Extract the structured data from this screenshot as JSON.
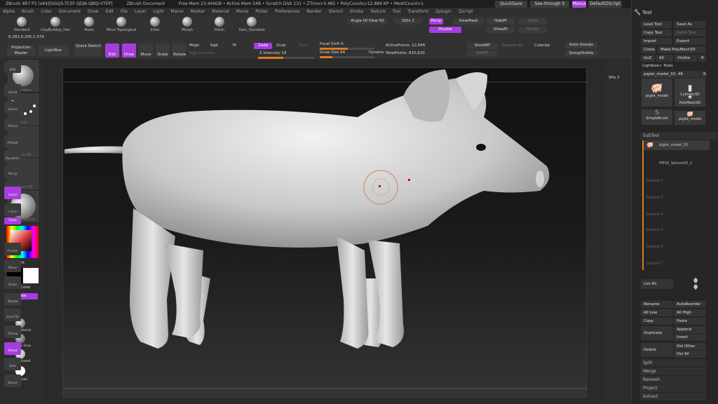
{
  "title_bar": {
    "app": "ZBrush 4R7 P3 (x64)[GGQS-TCSF-QDJK-QBQI-VTEP]",
    "document": "ZBrush Document",
    "stats": "Free Mem 23.449GB • Active Mem 548 • Scratch Disk 131 • ZTime>3.485 • PolyCounts>12.884 KP • MeshCount>1",
    "quicksave": "QuickSave",
    "see_through": "See-through 0",
    "menus_label": "Menus",
    "script_label": "DefaultZScript"
  },
  "menu": [
    "Alpha",
    "Brush",
    "Color",
    "Document",
    "Draw",
    "Edit",
    "File",
    "Layer",
    "Light",
    "Macro",
    "Marker",
    "Material",
    "Movie",
    "Picker",
    "Preferences",
    "Render",
    "Stencil",
    "Stroke",
    "Texture",
    "Tool",
    "Transform",
    "Zplugin",
    "Zscript"
  ],
  "brushes": [
    {
      "label": "Standard"
    },
    {
      "label": "ClayBuildup_Hon"
    },
    {
      "label": "Move"
    },
    {
      "label": "Move Topological"
    },
    {
      "label": "Inflat"
    },
    {
      "label": "Morph"
    },
    {
      "label": "Polish"
    },
    {
      "label": "Dam_Standard"
    }
  ],
  "coords": "-0.283,0.205,1.379",
  "top_controls": {
    "angle_of_view": "Angle Of View 50",
    "sdiv": "SDiv 1",
    "persp": "Persp",
    "double": "Double",
    "viewmask": "ViewMask",
    "hidept": "HidePt",
    "showpt": "ShowPt",
    "grow": "Grow",
    "shrink": "Shrink"
  },
  "toolbar": {
    "projection_master": "Projection Master",
    "lightbox": "LightBox",
    "quick_sketch": "Quick Sketch",
    "edit": "Edit",
    "draw": "Draw",
    "move": "Move",
    "scale": "Scale",
    "rotate": "Rotate",
    "mrgb": "Mrgb",
    "rgb": "Rgb",
    "m": "M",
    "rgb_intensity": "Rgb Intensity",
    "zadd": "Zadd",
    "zsub": "Zsub",
    "zcut": "Zcut",
    "z_intensity": "Z Intensity 19",
    "focal_shift": "Focal Shift 0",
    "draw_size": "Draw Size 64",
    "dynamic": "Dynamic",
    "active_points": "ActivePoints: 12,846",
    "total_points": "TotalPoints: 810,620",
    "storemt": "StoreMT",
    "delmt": "DelMT",
    "texture_on": "Texture On",
    "colorize": "Colorize",
    "auto_groups": "Auto Groups",
    "group_visible": "GroupVisible"
  },
  "left_shelf": {
    "brush": "Standard",
    "stroke": "Dots",
    "alpha": "Alpha Off",
    "texture": "Texture Off",
    "material": "BasicMaterial",
    "gradient": "Gradient",
    "switch_color": "SwitchColor",
    "alternate": "Alternate",
    "materials": [
      "BasicMaterial",
      "MatCap Gray",
      "SkinShade4",
      "Flat Color"
    ]
  },
  "right_shelf": [
    "BPR",
    "SPix 3",
    "Scroll",
    "Zoom",
    "Actual",
    "AAHalf",
    "Dynamic",
    "Persp",
    "Floor",
    "Local",
    "L.Sym",
    "Gxyz",
    "Frame",
    "Move",
    "Scale",
    "Rotate",
    "Line Fill",
    "PolyF",
    "Transp",
    "Ghost",
    "Solo",
    "Xpose"
  ],
  "tool_panel": {
    "title": "Tool",
    "load_tool": "Load Tool",
    "save_as": "Save As",
    "copy_tool": "Copy Tool",
    "paste_tool": "Paste Tool",
    "import": "Import",
    "export": "Export",
    "clone": "Clone",
    "make_polymesh": "Make PolyMesh3D",
    "goz": "GoZ",
    "all": "All",
    "visible": "Visible",
    "r": "R",
    "lightbox_tools": "Lightbox> Tools",
    "current_tool": "piglet_model_03. 48",
    "tools": [
      {
        "label": "piglet_model"
      },
      {
        "label": "Cylinder3D"
      },
      {
        "label": "PolyMesh3D"
      },
      {
        "label": "SimpleBrush"
      },
      {
        "label": "piglet_model"
      }
    ],
    "subtool_header": "SubTool",
    "subtools": [
      "piglet_model_03",
      "PM3D_Sphere3D_2"
    ],
    "empty_subtools": [
      "Subtool 2",
      "Subtool 3",
      "Subtool 4",
      "Subtool 5",
      "Subtool 6",
      "Subtool 7"
    ],
    "list_all": "List All",
    "rename": "Rename",
    "autoreorder": "AutoReorder",
    "all_low": "All Low",
    "all_high": "All High",
    "copy": "Copy",
    "paste": "Paste",
    "duplicate": "Duplicate",
    "append": "Append",
    "insert": "Insert",
    "delete": "Delete",
    "del_other": "Del Other",
    "del_all": "Del All",
    "split": "Split",
    "merge": "Merge",
    "remesh": "Remesh",
    "project": "Project",
    "extract": "Extract"
  }
}
